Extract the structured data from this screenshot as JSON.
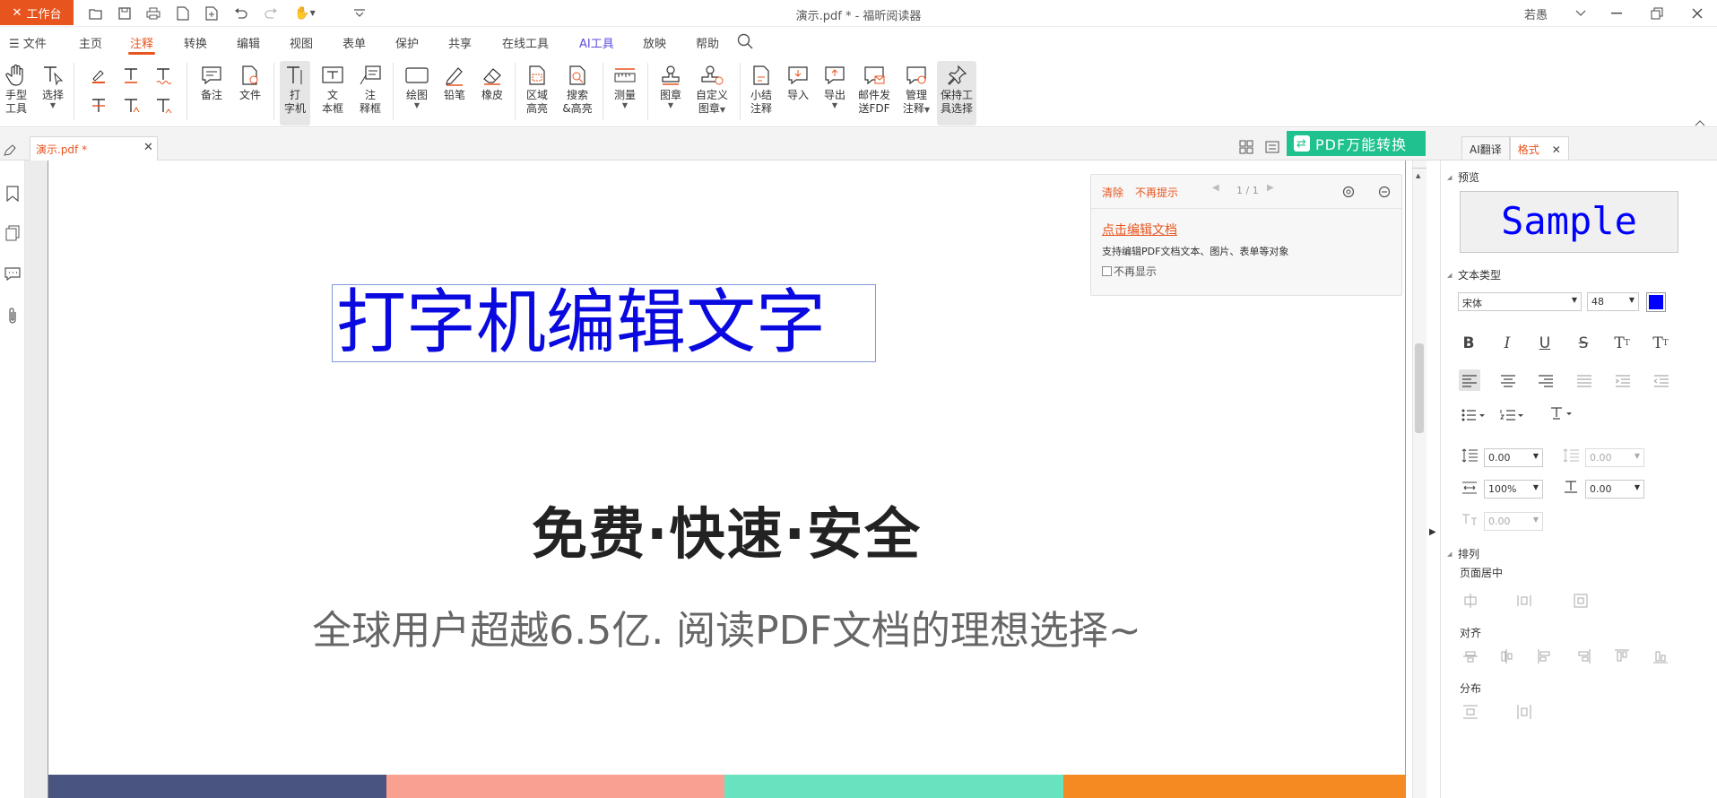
{
  "titlebar": {
    "workbench": "工作台",
    "window_title": "演示.pdf * - 福昕阅读器",
    "user": "若愚"
  },
  "menu": {
    "file": "文件",
    "items": [
      "主页",
      "注释",
      "转换",
      "编辑",
      "视图",
      "表单",
      "保护",
      "共享",
      "在线工具",
      "AI工具",
      "放映",
      "帮助"
    ],
    "active": "注释"
  },
  "ribbon": {
    "hand_l1": "手型",
    "hand_l2": "工具",
    "select": "选择",
    "note": "备注",
    "file_att": "文件",
    "type_l1": "打",
    "type_l2": "字机",
    "textbox_l1": "文",
    "textbox_l2": "本框",
    "callout_l1": "注",
    "callout_l2": "释框",
    "draw": "绘图",
    "pencil": "铅笔",
    "eraser": "橡皮",
    "area_l1": "区域",
    "area_l2": "高亮",
    "search_l1": "搜索",
    "search_l2": "&高亮",
    "measure": "测量",
    "stamp": "图章",
    "custom_l1": "自定义",
    "custom_l2": "图章",
    "summary_l1": "小结",
    "summary_l2": "注释",
    "import": "导入",
    "export": "导出",
    "email_l1": "邮件发",
    "email_l2": "送FDF",
    "manage_l1": "管理",
    "manage_l2": "注释",
    "keep_l1": "保持工",
    "keep_l2": "具选择"
  },
  "tabs": {
    "doc_tab": "演示.pdf *",
    "pdf_convert": "PDF万能转换",
    "ai_translate": "AI翻译",
    "format": "格式"
  },
  "tip": {
    "clear": "清除",
    "no_remind": "不再提示",
    "pager": "1 / 1",
    "link": "点击编辑文档",
    "desc": "支持编辑PDF文档文本、图片、表单等对象",
    "checkbox_label": "不再显示"
  },
  "document": {
    "typewriter_text": "打字机编辑文字",
    "slogan": "免费·快速·安全",
    "subtitle": "全球用户超越6.5亿. 阅读PDF文档的理想选择~",
    "bar_colors": [
      "#4a5480",
      "#f9a090",
      "#68e3c0",
      "#f58a22"
    ]
  },
  "format_panel": {
    "preview_label": "预览",
    "preview_sample": "Sample",
    "text_type_label": "文本类型",
    "font": "宋体",
    "size": "48",
    "color": "#0000ff",
    "line_spacing": "0.00",
    "para_spacing": "0.00",
    "scale": "100%",
    "char_spacing": "0.00",
    "baseline": "0.00",
    "arrange_label": "排列",
    "page_center": "页面居中",
    "align": "对齐",
    "distribute": "分布"
  },
  "colors": {
    "accent": "#e8541e",
    "convert": "#1fc28e",
    "typewriter": "#0a0ae0"
  }
}
